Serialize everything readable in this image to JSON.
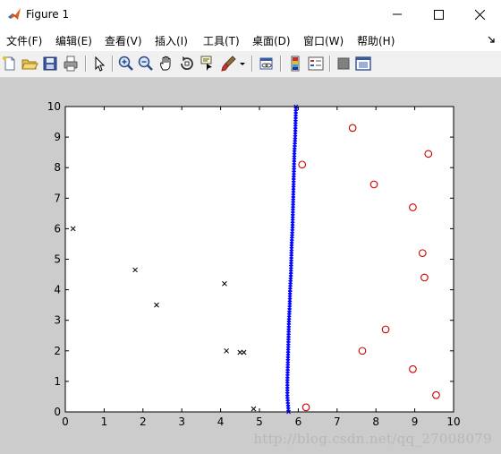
{
  "window": {
    "title": "Figure 1",
    "minimize_icon": "minimize-icon",
    "maximize_icon": "maximize-icon",
    "close_icon": "close-icon"
  },
  "menu": [
    {
      "label": "文件(F)"
    },
    {
      "label": "编辑(E)"
    },
    {
      "label": "查看(V)"
    },
    {
      "label": "插入(I)"
    },
    {
      "label": "工具(T)"
    },
    {
      "label": "桌面(D)"
    },
    {
      "label": "窗口(W)"
    },
    {
      "label": "帮助(H)"
    }
  ],
  "toolbar": {
    "icons": [
      "new-figure-icon",
      "open-file-icon",
      "save-icon",
      "print-icon",
      "pointer-icon",
      "zoom-in-icon",
      "zoom-out-icon",
      "pan-icon",
      "rotate-3d-icon",
      "data-cursor-icon",
      "brush-icon",
      "brush-dropdown-icon",
      "link-plot-icon",
      "colorbar-icon",
      "legend-icon",
      "hide-plot-tools-icon",
      "show-plot-tools-icon"
    ]
  },
  "watermark": "http://blog.csdn.net/qq_27008079",
  "chart_data": {
    "type": "scatter",
    "xlim": [
      0,
      10
    ],
    "ylim": [
      0,
      10
    ],
    "xticks": [
      "0",
      "1",
      "2",
      "3",
      "4",
      "5",
      "6",
      "7",
      "8",
      "9",
      "10"
    ],
    "yticks": [
      "0",
      "1",
      "2",
      "3",
      "4",
      "5",
      "6",
      "7",
      "8",
      "9",
      "10"
    ],
    "grid": false,
    "series": [
      {
        "marker": "x",
        "color": "#000000",
        "points": [
          [
            0.2,
            6.0
          ],
          [
            1.8,
            4.65
          ],
          [
            2.35,
            3.5
          ],
          [
            4.1,
            4.2
          ],
          [
            4.15,
            2.0
          ],
          [
            4.5,
            1.95
          ],
          [
            4.6,
            1.95
          ],
          [
            4.85,
            0.1
          ]
        ]
      },
      {
        "marker": "o",
        "color": "#cc0000",
        "points": [
          [
            6.1,
            8.1
          ],
          [
            6.2,
            0.15
          ],
          [
            7.4,
            9.3
          ],
          [
            7.65,
            2.0
          ],
          [
            7.95,
            7.45
          ],
          [
            8.25,
            2.7
          ],
          [
            8.95,
            6.7
          ],
          [
            8.95,
            1.4
          ],
          [
            9.2,
            5.2
          ],
          [
            9.25,
            4.4
          ],
          [
            9.35,
            8.45
          ],
          [
            9.55,
            0.55
          ]
        ]
      },
      {
        "marker": "x-line",
        "color": "#0000ff",
        "points": [
          [
            5.75,
            0.0
          ],
          [
            5.72,
            0.5
          ],
          [
            5.72,
            1.0
          ],
          [
            5.73,
            1.5
          ],
          [
            5.74,
            2.0
          ],
          [
            5.75,
            2.5
          ],
          [
            5.76,
            3.0
          ],
          [
            5.78,
            3.5
          ],
          [
            5.79,
            4.0
          ],
          [
            5.81,
            4.5
          ],
          [
            5.82,
            5.0
          ],
          [
            5.83,
            5.5
          ],
          [
            5.85,
            6.0
          ],
          [
            5.86,
            6.5
          ],
          [
            5.87,
            7.0
          ],
          [
            5.88,
            7.5
          ],
          [
            5.89,
            8.0
          ],
          [
            5.9,
            8.5
          ],
          [
            5.92,
            9.0
          ],
          [
            5.93,
            9.5
          ],
          [
            5.94,
            10.0
          ]
        ]
      }
    ]
  }
}
